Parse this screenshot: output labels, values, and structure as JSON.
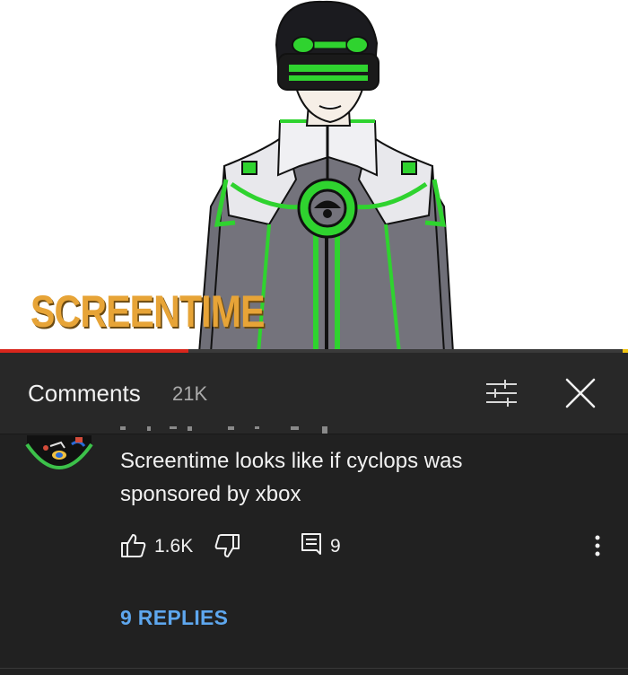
{
  "video": {
    "brand_text": "SCREENTIME",
    "progress_fraction": 0.3,
    "colors": {
      "brand": "#e7a437",
      "progress": "#d8261c",
      "suit_green": "#2fd32f"
    }
  },
  "comments_panel": {
    "title": "Comments",
    "count": "21K",
    "filter_icon": "sort-filter-icon",
    "close_icon": "close-icon"
  },
  "comment": {
    "text": "Screentime looks like if cyclops was sponsored by xbox",
    "likes": "1.6K",
    "reply_count_badge": "9",
    "replies_link": "9 REPLIES",
    "icons": [
      "thumbs-up-icon",
      "thumbs-down-icon",
      "reply-icon",
      "more-vert-icon"
    ]
  },
  "theme": {
    "background": "#212121",
    "header": "#282828",
    "link": "#5ea7ee"
  }
}
